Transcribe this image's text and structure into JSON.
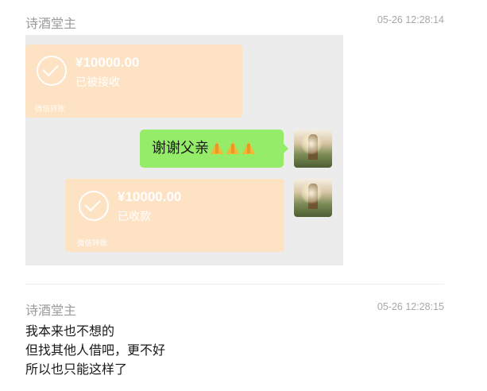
{
  "post1": {
    "author": "诗酒堂主",
    "time": "05-26 12:28:14",
    "screenshot": {
      "transfer_top": {
        "amount": "¥10000.00",
        "status": "已被接收",
        "label": "微信转账"
      },
      "message": {
        "text": "谢谢父亲",
        "emoji": "🙏🙏🙏"
      },
      "transfer_bottom": {
        "amount": "¥10000.00",
        "status": "已收款",
        "label": "微信转账"
      }
    }
  },
  "post2": {
    "author": "诗酒堂主",
    "time": "05-26 12:28:15",
    "lines": [
      "我本来也不想的",
      "但找其他人借吧，更不好",
      "所以也只能这样了"
    ]
  },
  "colors": {
    "transfer_bg": "#fde2c4",
    "bubble_bg": "#95ec69",
    "screenshot_bg": "#ececec",
    "meta_text": "#9a9a9a"
  }
}
